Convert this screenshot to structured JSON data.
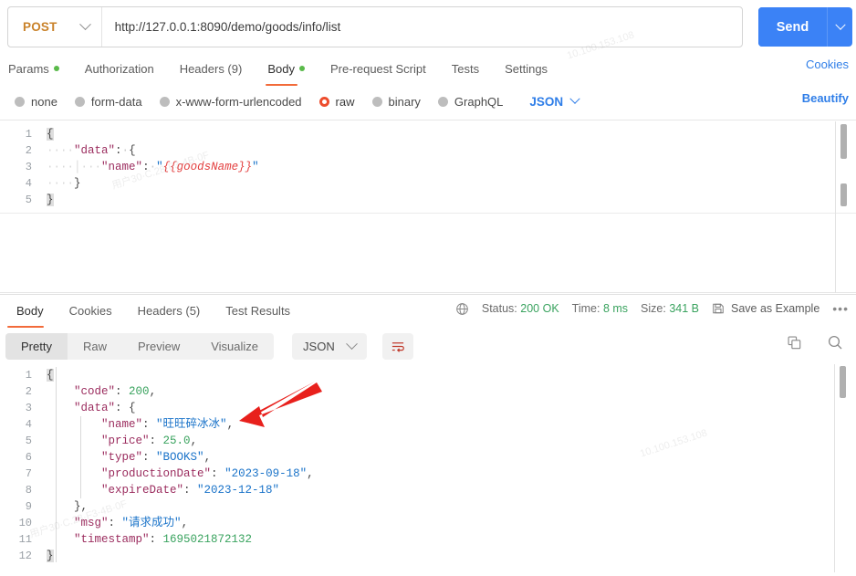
{
  "request": {
    "method": "POST",
    "url": "http://127.0.0.1:8090/demo/goods/info/list",
    "send_label": "Send",
    "cookies_label": "Cookies",
    "beautify_label": "Beautify",
    "tabs": [
      {
        "label": "Params",
        "dot": true,
        "active": false
      },
      {
        "label": "Authorization",
        "dot": false,
        "active": false
      },
      {
        "label": "Headers (9)",
        "dot": false,
        "active": false
      },
      {
        "label": "Body",
        "dot": true,
        "active": true
      },
      {
        "label": "Pre-request Script",
        "dot": false,
        "active": false
      },
      {
        "label": "Tests",
        "dot": false,
        "active": false
      },
      {
        "label": "Settings",
        "dot": false,
        "active": false
      }
    ],
    "body_types": [
      {
        "label": "none",
        "selected": false
      },
      {
        "label": "form-data",
        "selected": false
      },
      {
        "label": "x-www-form-urlencoded",
        "selected": false
      },
      {
        "label": "raw",
        "selected": true
      },
      {
        "label": "binary",
        "selected": false
      },
      {
        "label": "GraphQL",
        "selected": false
      }
    ],
    "format": "JSON",
    "body_lines": [
      {
        "n": "1",
        "tokens": [
          {
            "t": "{",
            "c": "brace-hl p"
          }
        ]
      },
      {
        "n": "2",
        "tokens": [
          {
            "t": "····",
            "c": "ind"
          },
          {
            "t": "\"data\"",
            "c": "k"
          },
          {
            "t": ":",
            "c": "p"
          },
          {
            "t": "·",
            "c": "gap"
          },
          {
            "t": "{",
            "c": "p"
          }
        ]
      },
      {
        "n": "3",
        "tokens": [
          {
            "t": "····",
            "c": "ind"
          },
          {
            "t": "│",
            "c": "ind"
          },
          {
            "t": "···",
            "c": "ind"
          },
          {
            "t": "\"name\"",
            "c": "k"
          },
          {
            "t": ":",
            "c": "p"
          },
          {
            "t": "·",
            "c": "gap"
          },
          {
            "t": "\"",
            "c": "s"
          },
          {
            "t": "{{goodsName}}",
            "c": "var"
          },
          {
            "t": "\"",
            "c": "s"
          }
        ]
      },
      {
        "n": "4",
        "tokens": [
          {
            "t": "··",
            "c": "ind"
          },
          {
            "t": "··",
            "c": "ind"
          },
          {
            "t": "}",
            "c": "p"
          }
        ]
      },
      {
        "n": "5",
        "tokens": [
          {
            "t": "}",
            "c": "brace-hl p"
          }
        ]
      }
    ]
  },
  "response": {
    "tabs": [
      {
        "label": "Body",
        "active": true
      },
      {
        "label": "Cookies",
        "active": false
      },
      {
        "label": "Headers (5)",
        "active": false
      },
      {
        "label": "Test Results",
        "active": false
      }
    ],
    "status_label": "Status:",
    "status_value": "200 OK",
    "time_label": "Time:",
    "time_value": "8 ms",
    "size_label": "Size:",
    "size_value": "341 B",
    "save_example_label": "Save as Example",
    "kebab": "•••",
    "view_modes": [
      {
        "label": "Pretty",
        "active": true
      },
      {
        "label": "Raw",
        "active": false
      },
      {
        "label": "Preview",
        "active": false
      },
      {
        "label": "Visualize",
        "active": false
      }
    ],
    "format": "JSON",
    "body_lines": [
      {
        "n": "1",
        "tokens": [
          {
            "t": "{",
            "c": "brace-hl p"
          }
        ]
      },
      {
        "n": "2",
        "tokens": [
          {
            "t": "    ",
            "c": "p"
          },
          {
            "t": "\"code\"",
            "c": "k"
          },
          {
            "t": ": ",
            "c": "p"
          },
          {
            "t": "200",
            "c": "n"
          },
          {
            "t": ",",
            "c": "p"
          }
        ]
      },
      {
        "n": "3",
        "tokens": [
          {
            "t": "    ",
            "c": "p"
          },
          {
            "t": "\"data\"",
            "c": "k"
          },
          {
            "t": ": ",
            "c": "p"
          },
          {
            "t": "{",
            "c": "p"
          }
        ]
      },
      {
        "n": "4",
        "tokens": [
          {
            "t": "        ",
            "c": "p"
          },
          {
            "t": "\"name\"",
            "c": "k"
          },
          {
            "t": ": ",
            "c": "p"
          },
          {
            "t": "\"旺旺碎冰冰\"",
            "c": "s"
          },
          {
            "t": ",",
            "c": "p"
          }
        ]
      },
      {
        "n": "5",
        "tokens": [
          {
            "t": "        ",
            "c": "p"
          },
          {
            "t": "\"price\"",
            "c": "k"
          },
          {
            "t": ": ",
            "c": "p"
          },
          {
            "t": "25.0",
            "c": "n"
          },
          {
            "t": ",",
            "c": "p"
          }
        ]
      },
      {
        "n": "6",
        "tokens": [
          {
            "t": "        ",
            "c": "p"
          },
          {
            "t": "\"type\"",
            "c": "k"
          },
          {
            "t": ": ",
            "c": "p"
          },
          {
            "t": "\"BOOKS\"",
            "c": "s"
          },
          {
            "t": ",",
            "c": "p"
          }
        ]
      },
      {
        "n": "7",
        "tokens": [
          {
            "t": "        ",
            "c": "p"
          },
          {
            "t": "\"productionDate\"",
            "c": "k"
          },
          {
            "t": ": ",
            "c": "p"
          },
          {
            "t": "\"2023-09-18\"",
            "c": "s"
          },
          {
            "t": ",",
            "c": "p"
          }
        ]
      },
      {
        "n": "8",
        "tokens": [
          {
            "t": "        ",
            "c": "p"
          },
          {
            "t": "\"expireDate\"",
            "c": "k"
          },
          {
            "t": ": ",
            "c": "p"
          },
          {
            "t": "\"2023-12-18\"",
            "c": "s"
          }
        ]
      },
      {
        "n": "9",
        "tokens": [
          {
            "t": "    ",
            "c": "p"
          },
          {
            "t": "}",
            "c": "p"
          },
          {
            "t": ",",
            "c": "p"
          }
        ]
      },
      {
        "n": "10",
        "tokens": [
          {
            "t": "    ",
            "c": "p"
          },
          {
            "t": "\"msg\"",
            "c": "k"
          },
          {
            "t": ": ",
            "c": "p"
          },
          {
            "t": "\"请求成功\"",
            "c": "s"
          },
          {
            "t": ",",
            "c": "p"
          }
        ]
      },
      {
        "n": "11",
        "tokens": [
          {
            "t": "    ",
            "c": "p"
          },
          {
            "t": "\"timestamp\"",
            "c": "k"
          },
          {
            "t": ": ",
            "c": "p"
          },
          {
            "t": "1695021872132",
            "c": "n"
          }
        ]
      },
      {
        "n": "12",
        "tokens": [
          {
            "t": "}",
            "c": "brace-hl p"
          }
        ]
      }
    ]
  },
  "colors": {
    "send_blue": "#3b82f6",
    "method_orange": "#c9822a",
    "tab_underline": "#f26b3a",
    "status_green": "#3aa35f",
    "link_blue": "#2f7ee8",
    "arrow_red": "#e8201c",
    "raw_radio": "#ed4d2d",
    "json_string": "#1a73c9",
    "json_key": "#9b2c5e",
    "json_var": "#e34040"
  },
  "watermarks": [
    "10.100.153.108",
    "用户30·C.28·F3·4B·0F"
  ]
}
